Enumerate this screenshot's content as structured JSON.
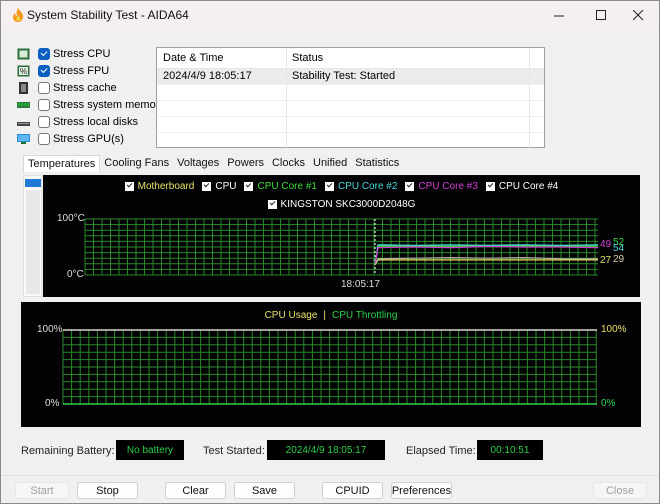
{
  "window": {
    "title": "System Stability Test - AIDA64",
    "minimize_icon": "minimize-icon",
    "maximize_icon": "maximize-icon",
    "close_icon": "close-icon"
  },
  "stress": [
    {
      "label": "Stress CPU",
      "checked": true,
      "icon": "cpu-icon"
    },
    {
      "label": "Stress FPU",
      "checked": true,
      "icon": "fpu-icon"
    },
    {
      "label": "Stress cache",
      "checked": false,
      "icon": "cache-icon"
    },
    {
      "label": "Stress system memory",
      "checked": false,
      "icon": "memory-icon"
    },
    {
      "label": "Stress local disks",
      "checked": false,
      "icon": "disk-icon"
    },
    {
      "label": "Stress GPU(s)",
      "checked": false,
      "icon": "gpu-icon"
    }
  ],
  "log": {
    "headers": [
      "Date & Time",
      "Status"
    ],
    "rows": [
      {
        "datetime": "2024/4/9 18:05:17",
        "status": "Stability Test: Started"
      }
    ]
  },
  "tabs": [
    "Temperatures",
    "Cooling Fans",
    "Voltages",
    "Powers",
    "Clocks",
    "Unified",
    "Statistics"
  ],
  "active_tab": "Temperatures",
  "colors": {
    "motherboard": "#e8e06a",
    "cpu": "#ffffff",
    "core1": "#3ddc3d",
    "core2": "#46d8d8",
    "core3": "#d040d0",
    "core4": "#ffffff",
    "kingston": "#ffffff",
    "grid": "#2a8a2a",
    "usage": "#e8e06a",
    "throttling": "#2fd14a"
  },
  "chart_data": [
    {
      "type": "line",
      "title": "Temperatures",
      "legend": [
        "Motherboard",
        "CPU",
        "CPU Core #1",
        "CPU Core #2",
        "CPU Core #3",
        "CPU Core #4",
        "KINGSTON SKC3000D2048G"
      ],
      "ylabel_top": "100°C",
      "ylabel_bottom": "0°C",
      "ylim": [
        0,
        100
      ],
      "x_marker_label": "18:05:17",
      "current_values": [
        {
          "series": "CPU Core #3",
          "value": 49
        },
        {
          "series": "CPU Core #1",
          "value": 52
        },
        {
          "series": "CPU Core #2",
          "value": 54
        },
        {
          "series": "Motherboard",
          "value": 27
        },
        {
          "series": "KINGSTON SKC3000D2048G",
          "value": 29
        }
      ],
      "series": [
        {
          "name": "CPU Core #1",
          "values": [
            52,
            52,
            51,
            53,
            52,
            52,
            52
          ]
        },
        {
          "name": "CPU Core #2",
          "values": [
            54,
            53,
            54,
            53,
            54,
            53,
            54
          ]
        },
        {
          "name": "CPU Core #3",
          "values": [
            49,
            50,
            49,
            51,
            50,
            50,
            49
          ]
        },
        {
          "name": "Motherboard",
          "values": [
            27,
            27,
            27,
            27,
            27,
            27,
            27
          ]
        },
        {
          "name": "KINGSTON SKC3000D2048G",
          "values": [
            29,
            30,
            31,
            30,
            31,
            29,
            29
          ]
        }
      ]
    },
    {
      "type": "line",
      "title": "CPU Usage | CPU Throttling",
      "legend": [
        "CPU Usage",
        "CPU Throttling"
      ],
      "ylabel_top_left": "100%",
      "ylabel_bottom_left": "0%",
      "ylabel_top_right": "100%",
      "ylabel_bottom_right": "0%",
      "ylim": [
        0,
        100
      ],
      "series": [
        {
          "name": "CPU Usage",
          "values": [
            100,
            100
          ]
        },
        {
          "name": "CPU Throttling",
          "values": [
            0,
            0
          ]
        }
      ]
    }
  ],
  "status": {
    "battery_label": "Remaining Battery:",
    "battery_value": "No battery",
    "started_label": "Test Started:",
    "started_value": "2024/4/9 18:05:17",
    "elapsed_label": "Elapsed Time:",
    "elapsed_value": "00:10:51"
  },
  "buttons": {
    "start": "Start",
    "stop": "Stop",
    "clear": "Clear",
    "save": "Save",
    "cpuid": "CPUID",
    "preferences": "Preferences",
    "close": "Close"
  }
}
